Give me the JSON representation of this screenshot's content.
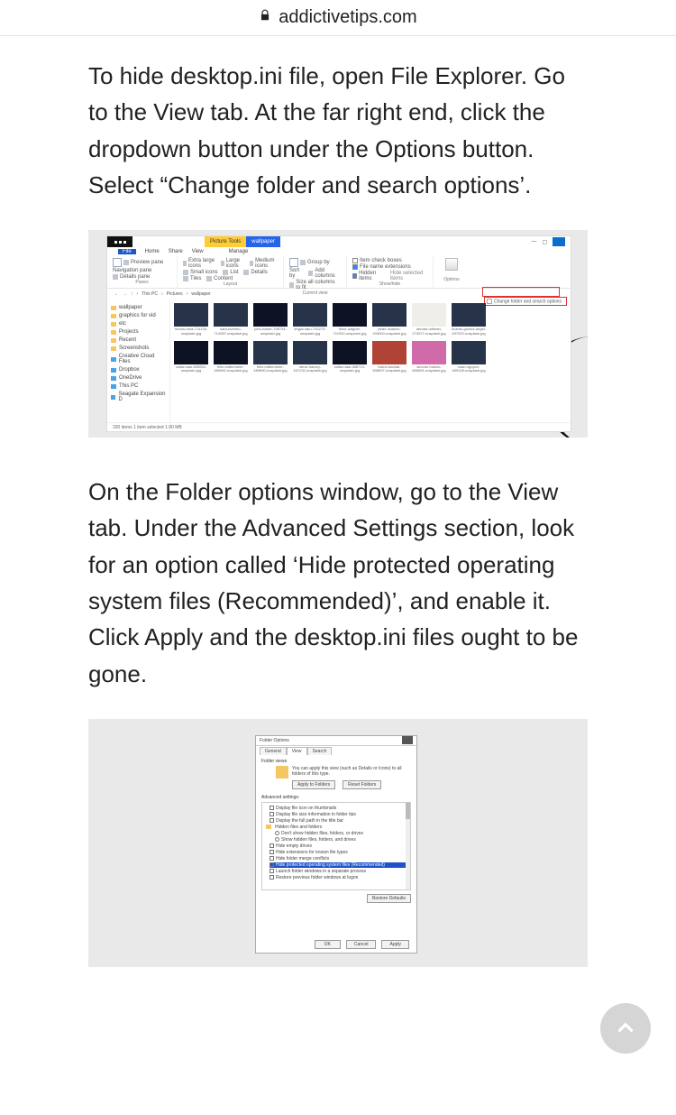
{
  "browser": {
    "domain": "addictivetips.com"
  },
  "article": {
    "p1": "To hide desktop.ini file, open File Explorer. Go to the View tab. At the far right end, click the dropdown button under the Options button. Select “Change folder and search options’.",
    "p2": "On the Folder options window, go to the View tab. Under the Advanced Settings section, look for an option called ‘Hide protected operating system files (Recommended)’, and enable it. Click Apply and the desktop.ini files ought to be gone."
  },
  "explorer": {
    "title_tool_tab": "Picture Tools",
    "title_context": "wallpaper",
    "menu_tabs": [
      "File",
      "Home",
      "Share",
      "View",
      "Manage"
    ],
    "ribbon": {
      "panes": {
        "label": "Panes",
        "items": [
          "Navigation pane",
          "Preview pane",
          "Details pane"
        ]
      },
      "layout": {
        "label": "Layout",
        "items": [
          "Extra large icons",
          "Large icons",
          "Medium icons",
          "Small icons",
          "List",
          "Details",
          "Tiles",
          "Content"
        ]
      },
      "current_view": {
        "label": "Current view",
        "items": [
          "Sort by",
          "Group by",
          "Add columns",
          "Size all columns to fit"
        ]
      },
      "show_hide": {
        "label": "Show/hide",
        "items": [
          "Item check boxes",
          "File name extensions",
          "Hidden items"
        ],
        "hide_selected": "Hide selected items"
      },
      "options": {
        "label": "Options",
        "menu_item": "Change folder and search options"
      }
    },
    "callout_number": "",
    "breadcrumb": [
      "This PC",
      "Pictures",
      "wallpaper"
    ],
    "sidebar": [
      {
        "icon": "folder",
        "label": "wallpaper"
      },
      {
        "icon": "folder",
        "label": "graphics for vid"
      },
      {
        "icon": "folder",
        "label": "etc"
      },
      {
        "icon": "folder",
        "label": "Projects"
      },
      {
        "icon": "folder",
        "label": "Recent"
      },
      {
        "icon": "folder",
        "label": "Screenshots"
      },
      {
        "icon": "cloud",
        "label": "Creative Cloud Files"
      },
      {
        "icon": "dropbox",
        "label": "Dropbox"
      },
      {
        "icon": "onedrive",
        "label": "OneDrive"
      },
      {
        "icon": "pc",
        "label": "This PC"
      },
      {
        "icon": "drive",
        "label": "Seagate Expansion D"
      }
    ],
    "thumbs_row1": [
      "roman-rana-714134-unsplash.jpg",
      "sara-kurento-714087-unsplash.jpg",
      "john-fowler-708724-unsplash.jpg",
      "shyjal-raku-710279-unsplash.jpg",
      "timor-wagner-711932-unsplash.jpg",
      "peter-oslanec-333000-unsplash.jpg",
      "ahmad-odhean-273227-unsplash.jpg",
      "ricardo-gomez-angel-497922-unsplash.jpg"
    ],
    "thumbs_row2": [
      "zoltan-tasi-690054-unsplash.jpg",
      "felix-mittermeier-489962-unsplash.jpg",
      "felix-mittermeier-489890-unsplash.jpg",
      "steve-harvey-497232-unsplash.jpg",
      "zoltan-tasi-488713-unsplash.jpg",
      "frame-harirak-508007-unsplash.jpg",
      "simone-hutsch-890891-unsplash.jpg",
      "xuan-nguyen-489108-unsplash.jpg"
    ],
    "status": "330 items   1 item selected 1.00 MB"
  },
  "folder_options": {
    "title": "Folder Options",
    "tabs": [
      "General",
      "View",
      "Search"
    ],
    "folder_views_label": "Folder views",
    "folder_views_text": "You can apply this view (such as Details or Icons) to all folders of this type.",
    "apply_to_folders": "Apply to Folders",
    "reset_folders": "Reset Folders",
    "advanced_label": "Advanced settings:",
    "advanced": [
      {
        "type": "cb",
        "text": "Display file icon on thumbnails"
      },
      {
        "type": "cb",
        "text": "Display file size information in folder tips"
      },
      {
        "type": "cb",
        "text": "Display the full path in the title bar"
      },
      {
        "type": "fy",
        "text": "Hidden files and folders"
      },
      {
        "type": "rb",
        "text": "Don't show hidden files, folders, or drives"
      },
      {
        "type": "rb",
        "text": "Show hidden files, folders, and drives"
      },
      {
        "type": "cb",
        "text": "Hide empty drives"
      },
      {
        "type": "cb",
        "text": "Hide extensions for known file types"
      },
      {
        "type": "cb",
        "text": "Hide folder merge conflicts"
      },
      {
        "type": "cb",
        "text": "Hide protected operating system files (Recommended)",
        "selected": true
      },
      {
        "type": "cb",
        "text": "Launch folder windows in a separate process"
      },
      {
        "type": "cb",
        "text": "Restore previous folder windows at logon"
      }
    ],
    "restore_defaults": "Restore Defaults",
    "ok": "OK",
    "cancel": "Cancel",
    "apply": "Apply"
  }
}
